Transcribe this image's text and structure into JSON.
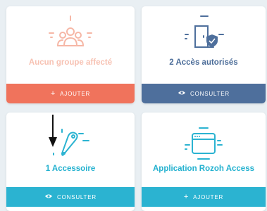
{
  "colors": {
    "coral": "#f0735c",
    "slate_blue": "#4e6f9c",
    "cyan": "#2bb3d1",
    "faded_coral": "#f7c2b3"
  },
  "cards": [
    {
      "title": "Aucun groupe affecté",
      "action_label": "AJOUTER",
      "action_icon": "plus-icon",
      "icon": "group-icon"
    },
    {
      "title": "2 Accès autorisés",
      "action_label": "CONSULTER",
      "action_icon": "eye-icon",
      "icon": "door-shield-icon"
    },
    {
      "title": "1 Accessoire",
      "action_label": "CONSULTER",
      "action_icon": "eye-icon",
      "icon": "key-fob-icon"
    },
    {
      "title": "Application Rozoh Access",
      "action_label": "AJOUTER",
      "action_icon": "plus-icon",
      "icon": "app-window-icon"
    }
  ]
}
